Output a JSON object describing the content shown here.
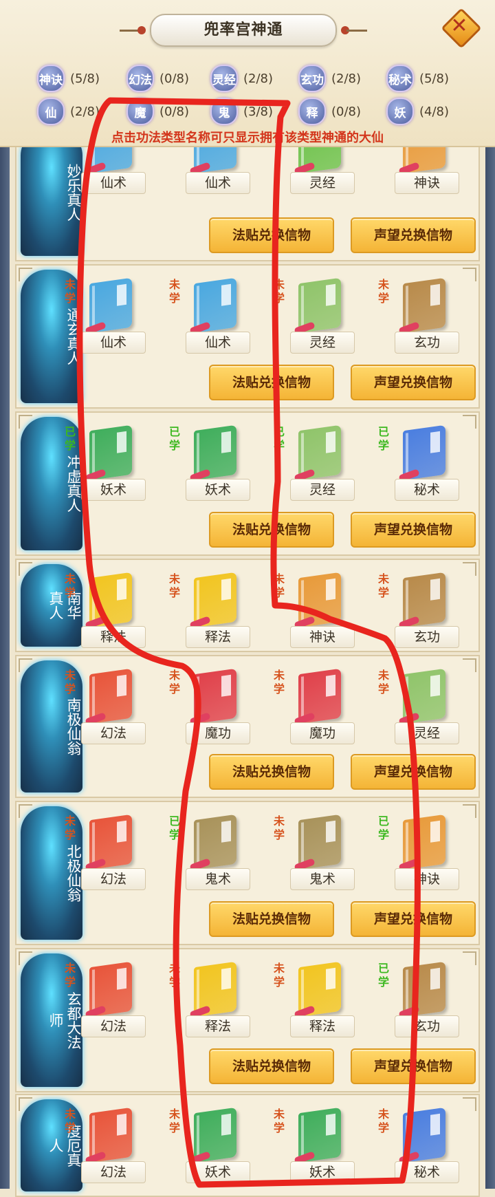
{
  "header": {
    "title": "兜率宫神通",
    "close_icon": "close-icon"
  },
  "filters": [
    {
      "icon_text": "神诀",
      "count": "(5/8)"
    },
    {
      "icon_text": "幻法",
      "count": "(0/8)"
    },
    {
      "icon_text": "灵经",
      "count": "(2/8)"
    },
    {
      "icon_text": "玄功",
      "count": "(2/8)"
    },
    {
      "icon_text": "秘术",
      "count": "(5/8)"
    },
    {
      "icon_text": "仙",
      "count": "(2/8)"
    },
    {
      "icon_text": "魔",
      "count": "(0/8)"
    },
    {
      "icon_text": "鬼",
      "count": "(3/8)"
    },
    {
      "icon_text": "释",
      "count": "(0/8)"
    },
    {
      "icon_text": "妖",
      "count": "(4/8)"
    }
  ],
  "hint": "点击功法类型名称可只显示拥有该类型神通的大仙",
  "status_labels": {
    "unlearned": "未学",
    "learned": "已学"
  },
  "buttons": {
    "fatie": "法贴兑换信物",
    "shengwang": "声望兑换信物"
  },
  "npcs": [
    {
      "name": "妙乐真人",
      "books": [
        {
          "label": "仙术",
          "status": "",
          "color": "#4aa8e0"
        },
        {
          "label": "仙术",
          "status": "",
          "color": "#4aa8e0"
        },
        {
          "label": "灵经",
          "status": "",
          "color": "#6cc24a"
        },
        {
          "label": "神诀",
          "status": "",
          "color": "#e89a3a"
        }
      ]
    },
    {
      "name": "通玄真人",
      "books": [
        {
          "label": "仙术",
          "status": "未学",
          "color": "#4aa8e0"
        },
        {
          "label": "仙术",
          "status": "未学",
          "color": "#4aa8e0"
        },
        {
          "label": "灵经",
          "status": "未学",
          "color": "#8fc46a"
        },
        {
          "label": "玄功",
          "status": "未学",
          "color": "#b88a4a"
        }
      ]
    },
    {
      "name": "冲虚真人",
      "books": [
        {
          "label": "妖术",
          "status": "已学",
          "color": "#3fae5c"
        },
        {
          "label": "妖术",
          "status": "已学",
          "color": "#3fae5c"
        },
        {
          "label": "灵经",
          "status": "已学",
          "color": "#8fc46a"
        },
        {
          "label": "秘术",
          "status": "已学",
          "color": "#4a7ee0"
        }
      ]
    },
    {
      "name": "南华真人",
      "books": [
        {
          "label": "释法",
          "status": "未学",
          "color": "#f2c520"
        },
        {
          "label": "释法",
          "status": "未学",
          "color": "#f2c520"
        },
        {
          "label": "神诀",
          "status": "未学",
          "color": "#e89a3a"
        },
        {
          "label": "玄功",
          "status": "未学",
          "color": "#b88a4a"
        }
      ]
    },
    {
      "name": "南极仙翁",
      "books": [
        {
          "label": "幻法",
          "status": "未学",
          "color": "#e8543a"
        },
        {
          "label": "魔功",
          "status": "未学",
          "color": "#e0404a"
        },
        {
          "label": "魔功",
          "status": "未学",
          "color": "#e0404a"
        },
        {
          "label": "灵经",
          "status": "未学",
          "color": "#8fc46a"
        }
      ]
    },
    {
      "name": "北极仙翁",
      "books": [
        {
          "label": "幻法",
          "status": "未学",
          "color": "#e8543a"
        },
        {
          "label": "鬼术",
          "status": "已学",
          "color": "#a8925a"
        },
        {
          "label": "鬼术",
          "status": "未学",
          "color": "#a8925a"
        },
        {
          "label": "神诀",
          "status": "已学",
          "color": "#e89a3a"
        }
      ]
    },
    {
      "name": "玄都大法师",
      "books": [
        {
          "label": "幻法",
          "status": "未学",
          "color": "#e8543a"
        },
        {
          "label": "释法",
          "status": "未学",
          "color": "#f2c520"
        },
        {
          "label": "释法",
          "status": "未学",
          "color": "#f2c520"
        },
        {
          "label": "玄功",
          "status": "已学",
          "color": "#b88a4a"
        }
      ]
    },
    {
      "name": "度厄真人",
      "books": [
        {
          "label": "幻法",
          "status": "未学",
          "color": "#e8543a"
        },
        {
          "label": "妖术",
          "status": "未学",
          "color": "#3fae5c"
        },
        {
          "label": "妖术",
          "status": "未学",
          "color": "#3fae5c"
        },
        {
          "label": "秘术",
          "status": "未学",
          "color": "#4a7ee0"
        }
      ]
    }
  ],
  "annotation_color": "#e8251e"
}
